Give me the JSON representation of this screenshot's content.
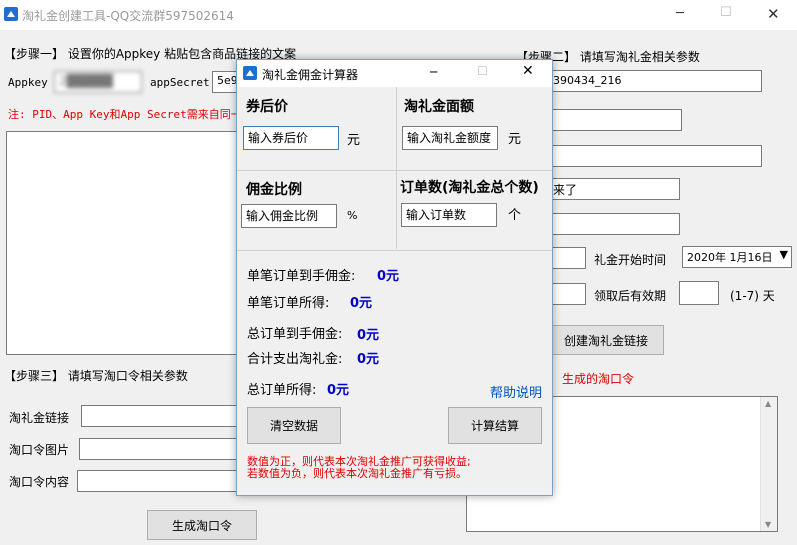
{
  "main_window": {
    "title": "淘礼金创建工具-QQ交流群597502614",
    "min_glyph": "─",
    "max_glyph": "☐",
    "close_glyph": "✕"
  },
  "step1": {
    "title": "【步骤一】 设置你的Appkey  粘贴包含商品链接的文案",
    "appkey_label": "Appkey",
    "appkey_value": "2█████",
    "appsecret_label": "appSecret",
    "appsecret_value": "5e9",
    "note": "注: PID、App Key和App Secret需来自同一"
  },
  "step2": {
    "title": "【步骤二】 请填写淘礼金相关参数",
    "pid_value": "390434_216",
    "name_value": "来了",
    "start_time_label": "礼金开始时间",
    "start_time_value": "2020年 1月16日",
    "valid_label": "领取后有效期",
    "valid_hint": "(1-7) 天",
    "create_button": "创建淘礼金链接",
    "generated_label": "生成的淘口令"
  },
  "step3": {
    "title": "【步骤三】 请填写淘口令相关参数",
    "link_label": "淘礼金链接",
    "image_label": "淘口令图片",
    "content_label": "淘口令内容",
    "generate_button": "生成淘口令"
  },
  "dialog": {
    "title": "淘礼金佣金计算器",
    "price_label": "券后价",
    "price_placeholder": "输入券后价",
    "price_unit": "元",
    "amount_label": "淘礼金面额",
    "amount_placeholder": "输入淘礼金额度",
    "amount_unit": "元",
    "rate_label": "佣金比例",
    "rate_placeholder": "输入佣金比例",
    "rate_unit": "%",
    "orders_label": "订单数(淘礼金总个数)",
    "orders_placeholder": "输入订单数",
    "orders_unit": "个",
    "single_commission_label": "单笔订单到手佣金:",
    "single_commission_value": "0元",
    "single_income_label": "单笔订单所得:",
    "single_income_value": "0元",
    "total_commission_label": "总订单到手佣金:",
    "total_commission_value": "0元",
    "total_spend_label": "合计支出淘礼金:",
    "total_spend_value": "0元",
    "total_income_label": "总订单所得:",
    "total_income_value": "0元",
    "help_link": "帮助说明",
    "clear_button": "清空数据",
    "calc_button": "计算结算",
    "note_line1": "数值为正，则代表本次淘礼金推广可获得收益;",
    "note_line2": "若数值为负，则代表本次淘礼金推广有亏损。"
  }
}
